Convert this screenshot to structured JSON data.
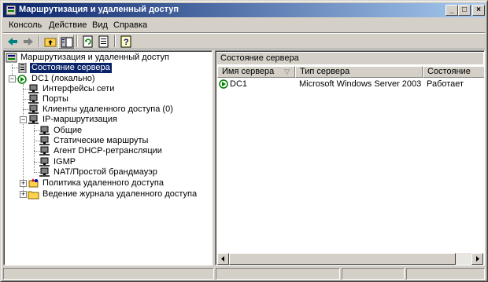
{
  "window": {
    "title": "Маршрутизация и удаленный доступ"
  },
  "menu": {
    "items": [
      "Консоль",
      "Действие",
      "Вид",
      "Справка"
    ]
  },
  "tree": {
    "root": "Маршрутизация и удаленный доступ",
    "server_status": "Состояние сервера",
    "server": "DC1 (локально)",
    "interfaces": "Интерфейсы сети",
    "ports": "Порты",
    "clients": "Клиенты удаленного доступа (0)",
    "ip_routing": "IP-маршрутизация",
    "general": "Общие",
    "static_routes": "Статические маршруты",
    "dhcp_relay": "Агент DHCP-ретрансляции",
    "igmp": "IGMP",
    "nat": "NAT/Простой брандмауэр",
    "policy": "Политика удаленного доступа",
    "logging": "Ведение журнала удаленного доступа"
  },
  "right": {
    "header": "Состояние сервера",
    "columns": [
      "Имя сервера",
      "Тип сервера",
      "Состояние"
    ],
    "rows": [
      {
        "name": "DC1",
        "type": "Microsoft Windows Server 2003 Se...",
        "status": "Работает"
      }
    ]
  },
  "colors": {
    "title_start": "#0a246a",
    "title_end": "#a6caf0",
    "selection": "#0a246a"
  }
}
